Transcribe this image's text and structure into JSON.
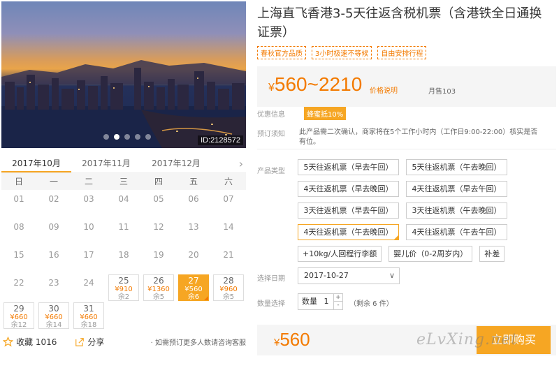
{
  "photo": {
    "id_label": "ID:2128572",
    "slides": 5,
    "active_slide": 1
  },
  "calendar": {
    "months": [
      "2017年10月",
      "2017年11月",
      "2017年12月"
    ],
    "active_month": 0,
    "weekdays": [
      "日",
      "一",
      "二",
      "三",
      "四",
      "五",
      "六"
    ],
    "days": [
      {
        "d": "01"
      },
      {
        "d": "02"
      },
      {
        "d": "03"
      },
      {
        "d": "04"
      },
      {
        "d": "05"
      },
      {
        "d": "06"
      },
      {
        "d": "07"
      },
      {
        "d": "08"
      },
      {
        "d": "09"
      },
      {
        "d": "10"
      },
      {
        "d": "11"
      },
      {
        "d": "12"
      },
      {
        "d": "13"
      },
      {
        "d": "14"
      },
      {
        "d": "15"
      },
      {
        "d": "16"
      },
      {
        "d": "17"
      },
      {
        "d": "18"
      },
      {
        "d": "19"
      },
      {
        "d": "20"
      },
      {
        "d": "21"
      },
      {
        "d": "22"
      },
      {
        "d": "23"
      },
      {
        "d": "24"
      },
      {
        "d": "25",
        "p": "¥910",
        "r": "余2"
      },
      {
        "d": "26",
        "p": "¥1360",
        "r": "余5"
      },
      {
        "d": "27",
        "p": "¥560",
        "r": "余6",
        "sel": true
      },
      {
        "d": "28",
        "p": "¥960",
        "r": "余5"
      },
      {
        "d": "29",
        "p": "¥660",
        "r": "余12"
      },
      {
        "d": "30",
        "p": "¥660",
        "r": "余14"
      },
      {
        "d": "31",
        "p": "¥660",
        "r": "余18"
      }
    ]
  },
  "footer_left": {
    "fav": "收藏 1016",
    "share": "分享",
    "hint": "· 如需预订更多人数请咨询客服"
  },
  "product": {
    "title": "上海直飞香港3-5天往返含税机票（含港铁全日通换证票）",
    "tags": [
      "春秋官方品质",
      "3小时极速不等候",
      "自由安排行程"
    ],
    "price_range": "560~2210",
    "currency": "¥",
    "price_note": "价格说明",
    "sold": "月售103",
    "promo_label": "优惠信息",
    "promo_tag": "蜂蜜抵10%",
    "notice_label": "预订须知",
    "notice_text": "此产品需二次确认，商家将在5个工作小时内（工作日9:00-22:00）核实是否有位。",
    "type_label": "产品类型",
    "options": [
      {
        "label": "5天往返机票（早去午回）"
      },
      {
        "label": "5天往返机票（午去晚回）"
      },
      {
        "label": "4天往返机票（早去晚回）"
      },
      {
        "label": "4天往返机票（早去午回）"
      },
      {
        "label": "3天往返机票（早去午回）"
      },
      {
        "label": "3天往返机票（午去晚回）"
      },
      {
        "label": "4天往返机票（午去晚回）",
        "sel": true
      },
      {
        "label": "4天往返机票（午去午回）"
      },
      {
        "label": "+10kg/人回程行李额"
      },
      {
        "label": "婴儿价（0-2周岁内）"
      },
      {
        "label": "补差"
      }
    ],
    "date_label": "选择日期",
    "date_value": "2017-10-27",
    "qty_label": "数量选择",
    "qty_text": "数量",
    "qty_value": "1",
    "qty_left": "（剩余 6 件）",
    "final_price": "560",
    "buy_label": "立即购买",
    "watermark": "eLvXing.net"
  },
  "icons": {
    "star": "star-icon",
    "share": "share-icon",
    "next": "chevron-right-icon",
    "select": "chevron-down-icon"
  }
}
